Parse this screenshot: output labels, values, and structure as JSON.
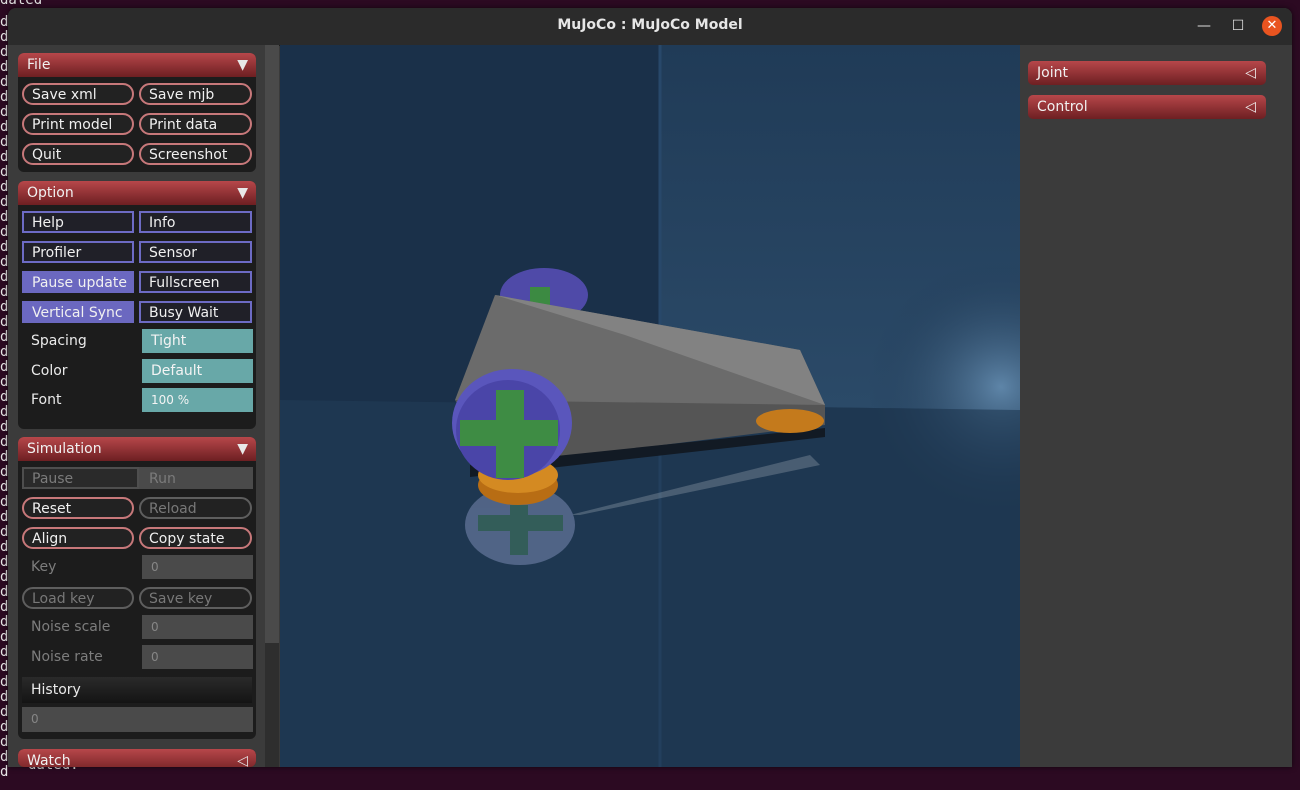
{
  "terminal": {
    "top_text": "dated",
    "bottom_text": "dated.",
    "lines": [
      "d",
      "d",
      "d",
      "d",
      "d",
      "d",
      "d",
      "d",
      "d",
      "d",
      "d",
      "d",
      "d",
      "d",
      "d",
      "d",
      "d",
      "d",
      "d",
      "d",
      "d",
      "d",
      "d",
      "d",
      "d",
      "d",
      "d",
      "d",
      "d",
      "d",
      "d",
      "d",
      "d",
      "d",
      "d",
      "d",
      "d",
      "d",
      "d",
      "d",
      "d",
      "d",
      "d",
      "d",
      "d",
      "d",
      "d",
      "d",
      "d",
      "d",
      "d"
    ]
  },
  "window": {
    "title": "MuJoCo : MuJoCo Model",
    "minimize_glyph": "—",
    "maximize_glyph": "☐",
    "close_glyph": "✕"
  },
  "file": {
    "header": "File",
    "arrow": "▼",
    "save_xml": "Save xml",
    "save_mjb": "Save mjb",
    "print_model": "Print model",
    "print_data": "Print data",
    "quit": "Quit",
    "screenshot": "Screenshot"
  },
  "option": {
    "header": "Option",
    "arrow": "▼",
    "help": "Help",
    "info": "Info",
    "profiler": "Profiler",
    "sensor": "Sensor",
    "pause_update": "Pause update",
    "fullscreen": "Fullscreen",
    "vertical_sync": "Vertical Sync",
    "busy_wait": "Busy Wait",
    "spacing_label": "Spacing",
    "spacing_value": "Tight",
    "color_label": "Color",
    "color_value": "Default",
    "font_label": "Font",
    "font_value": "100 %"
  },
  "simulation": {
    "header": "Simulation",
    "arrow": "▼",
    "pause": "Pause",
    "run": "Run",
    "reset": "Reset",
    "reload": "Reload",
    "align": "Align",
    "copy_state": "Copy state",
    "key_label": "Key",
    "key_value": "0",
    "load_key": "Load key",
    "save_key": "Save key",
    "noise_scale_label": "Noise scale",
    "noise_scale_value": "0",
    "noise_rate_label": "Noise rate",
    "noise_rate_value": "0",
    "history_label": "History",
    "history_value": "0"
  },
  "watch": {
    "header": "Watch",
    "arrow": "◁"
  },
  "right": {
    "joint": "Joint",
    "joint_arrow": "◁",
    "control": "Control",
    "control_arrow": "◁"
  },
  "colors": {
    "section_header": "#9a3437",
    "pill_border": "#c7787a",
    "option_border": "#6d6bc4",
    "option_active": "#6b68c0",
    "teal": "#68a8a8",
    "ground": "#1e3650"
  }
}
